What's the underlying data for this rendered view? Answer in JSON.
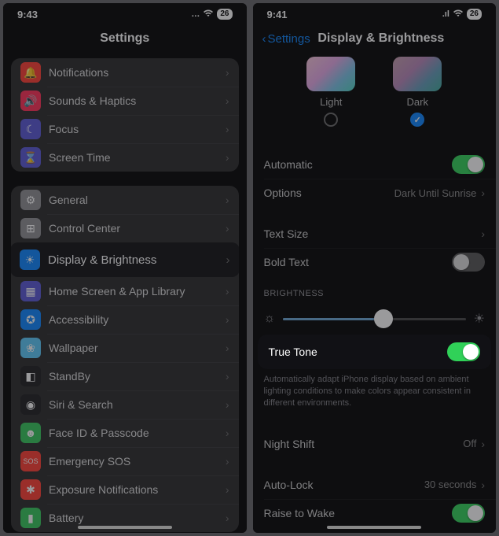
{
  "left": {
    "status_time": "9:43",
    "status_battery": "26",
    "header_title": "Settings",
    "groups": [
      [
        {
          "icon": "🔔",
          "bg": "#ff3b30",
          "label": "Notifications"
        },
        {
          "icon": "🔊",
          "bg": "#ff2d55",
          "label": "Sounds & Haptics"
        },
        {
          "icon": "☾",
          "bg": "#5856d6",
          "label": "Focus"
        },
        {
          "icon": "⌛",
          "bg": "#5856d6",
          "label": "Screen Time"
        }
      ],
      [
        {
          "icon": "⚙",
          "bg": "#8e8e93",
          "label": "General"
        },
        {
          "icon": "⊞",
          "bg": "#8e8e93",
          "label": "Control Center"
        },
        {
          "icon": "☀",
          "bg": "#0a84ff",
          "label": "Display & Brightness",
          "hl": true
        },
        {
          "icon": "▦",
          "bg": "#5856d6",
          "label": "Home Screen & App Library"
        },
        {
          "icon": "✪",
          "bg": "#0a84ff",
          "label": "Accessibility"
        },
        {
          "icon": "❀",
          "bg": "#5ac8fa",
          "label": "Wallpaper"
        },
        {
          "icon": "◧",
          "bg": "#1c1c1e",
          "label": "StandBy"
        },
        {
          "icon": "◉",
          "bg": "#1c1c1e",
          "label": "Siri & Search"
        },
        {
          "icon": "☻",
          "bg": "#34c759",
          "label": "Face ID & Passcode"
        },
        {
          "icon": "SOS",
          "bg": "#ff3b30",
          "label": "Emergency SOS",
          "small": true
        },
        {
          "icon": "✱",
          "bg": "#ff3b30",
          "label": "Exposure Notifications"
        },
        {
          "icon": "▮",
          "bg": "#34c759",
          "label": "Battery"
        }
      ]
    ]
  },
  "right": {
    "status_time": "9:41",
    "status_battery": "26",
    "back_label": "Settings",
    "title": "Display & Brightness",
    "appearance": {
      "light_label": "Light",
      "dark_label": "Dark",
      "selected": "dark"
    },
    "automatic_label": "Automatic",
    "automatic_on": true,
    "options_label": "Options",
    "options_value": "Dark Until Sunrise",
    "text_size_label": "Text Size",
    "bold_text_label": "Bold Text",
    "bold_text_on": false,
    "brightness_header": "Brightness",
    "brightness_pct": 55,
    "true_tone_label": "True Tone",
    "true_tone_on": true,
    "true_tone_caption": "Automatically adapt iPhone display based on ambient lighting conditions to make colors appear consistent in different environments.",
    "night_shift_label": "Night Shift",
    "night_shift_value": "Off",
    "auto_lock_label": "Auto-Lock",
    "auto_lock_value": "30 seconds",
    "raise_to_wake_label": "Raise to Wake",
    "raise_to_wake_on": true
  }
}
